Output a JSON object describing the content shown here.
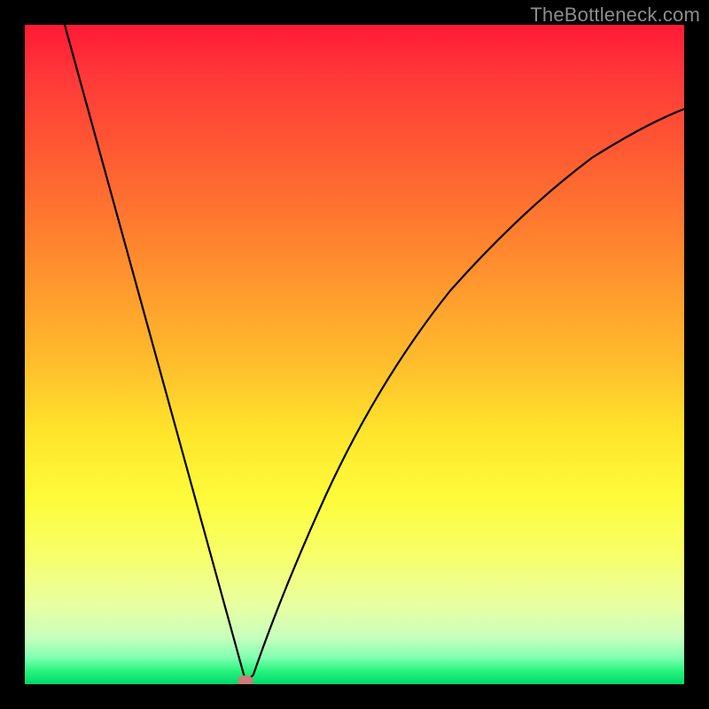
{
  "watermark": "TheBottleneck.com",
  "chart_data": {
    "type": "line",
    "title": "",
    "xlabel": "",
    "ylabel": "",
    "xlim": [
      0,
      100
    ],
    "ylim": [
      0,
      100
    ],
    "grid": false,
    "legend": false,
    "background": "gradient-red-to-green-vertical",
    "series": [
      {
        "name": "bottleneck-curve",
        "color": "#000000",
        "x": [
          6,
          8,
          10,
          12,
          14,
          16,
          18,
          20,
          22,
          24,
          26,
          28,
          30,
          32,
          33,
          34,
          36,
          38,
          40,
          42,
          45,
          48,
          52,
          56,
          60,
          65,
          70,
          75,
          80,
          85,
          90,
          95,
          100
        ],
        "y": [
          100,
          93,
          86,
          78,
          71,
          64,
          57,
          50,
          43,
          36,
          28,
          21,
          14,
          5,
          0,
          3,
          12,
          20,
          27,
          33,
          41,
          48,
          55,
          61,
          66,
          71,
          75,
          78,
          81,
          83,
          85,
          86,
          87
        ]
      }
    ],
    "marker": {
      "name": "vertex-marker",
      "x": 33,
      "y": 0,
      "color": "#cf7b78",
      "shape": "ellipse"
    }
  }
}
